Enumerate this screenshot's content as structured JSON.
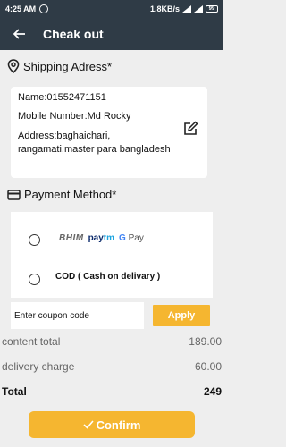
{
  "status_bar": {
    "time": "4:25 AM",
    "speed": "1.8KB/s",
    "battery": "99"
  },
  "app_bar": {
    "title": "Cheak out"
  },
  "shipping": {
    "heading": "Shipping Adress*",
    "name_line": "Name:01552471151",
    "mobile_line": "Mobile Number:Md Rocky",
    "address_line": "Address:baghaichari, rangamati,master para bangladesh"
  },
  "payment": {
    "heading": "Payment Method*",
    "options": [
      {
        "logos": [
          "BHIM",
          "Paytm",
          "G Pay"
        ]
      },
      {
        "label": "COD ( Cash on delivary )"
      }
    ],
    "paytm_a": "pay",
    "paytm_b": "tm",
    "gpay_g": "G",
    "gpay_pay": "Pay"
  },
  "coupon": {
    "placeholder": "Enter coupon code",
    "apply_label": "Apply"
  },
  "summary": {
    "content_total_label": "content total",
    "content_total_value": "189.00",
    "delivery_label": "delivery charge",
    "delivery_value": "60.00",
    "total_label": "Total",
    "total_value": "249"
  },
  "confirm_label": "Confirm",
  "colors": {
    "appbar": "#2f3b46",
    "accent": "#f5b630",
    "background": "#eeeeee"
  }
}
